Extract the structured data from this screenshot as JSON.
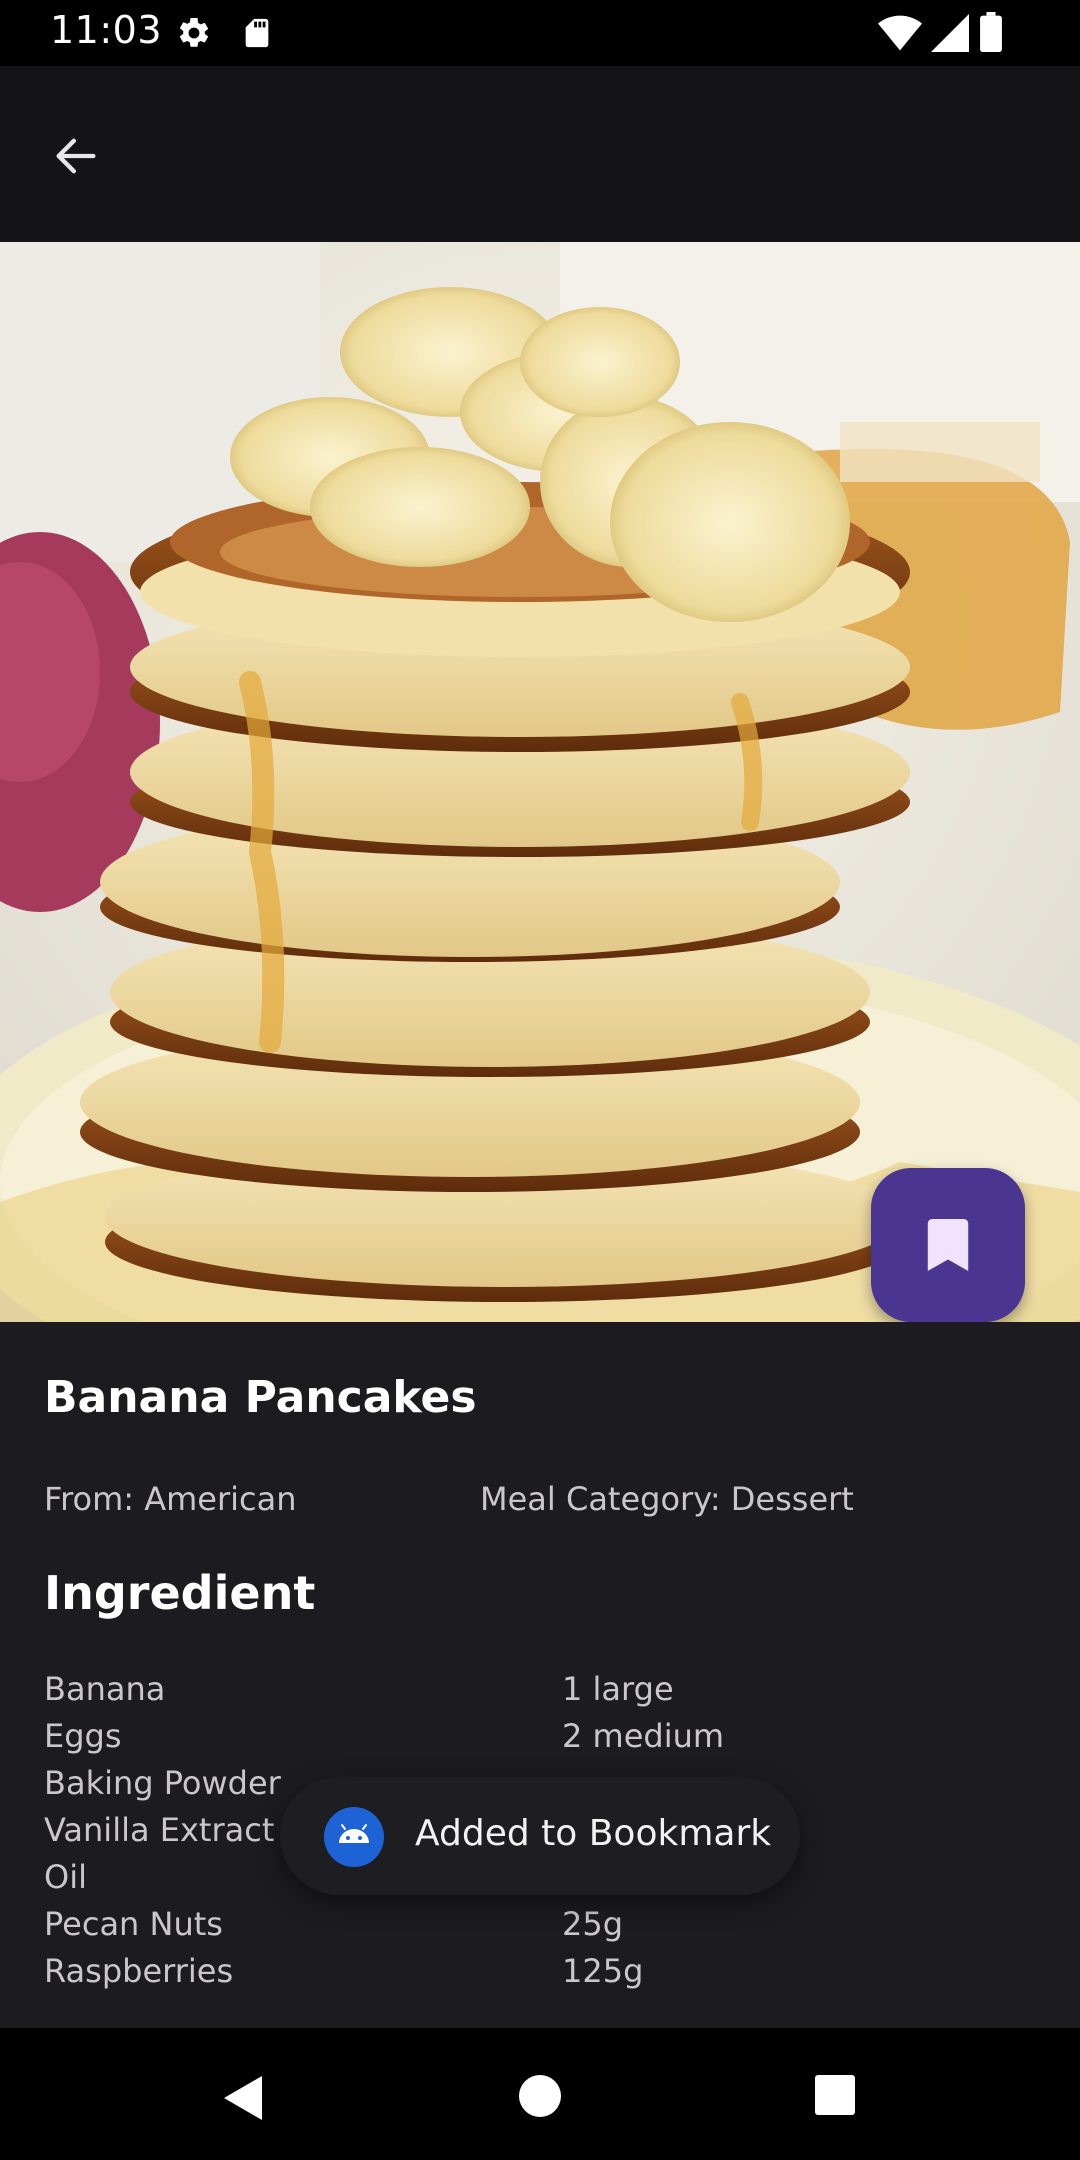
{
  "status_bar": {
    "time": "11:03",
    "icons": [
      "settings-icon",
      "sd-card-icon",
      "wifi-icon",
      "signal-icon",
      "battery-icon"
    ]
  },
  "app_bar": {
    "back_icon": "arrow-back-icon"
  },
  "recipe": {
    "title": "Banana Pancakes",
    "origin": "From: American",
    "category": "Meal Category: Dessert",
    "image_icon": "pancake-photo"
  },
  "fab": {
    "icon": "bookmark-icon",
    "color": "#4a3591"
  },
  "ingredients": {
    "heading": "Ingredient",
    "items": [
      {
        "name": "Banana",
        "qty": "1 large"
      },
      {
        "name": "Eggs",
        "qty": "2 medium"
      },
      {
        "name": "Baking Powder",
        "qty": ""
      },
      {
        "name": "Vanilla Extract",
        "qty": ""
      },
      {
        "name": "Oil",
        "qty": ""
      },
      {
        "name": "Pecan Nuts",
        "qty": "25g"
      },
      {
        "name": "Raspberries",
        "qty": "125g"
      }
    ]
  },
  "toast": {
    "message": "Added to Bookmark",
    "icon": "android-icon"
  },
  "nav_bar": {
    "icons": [
      "nav-back-icon",
      "nav-home-icon",
      "nav-recents-icon"
    ]
  },
  "colors": {
    "app_bar": "#141417",
    "content_bg": "#1c1b20",
    "secondary_text": "#c9c7cc",
    "accent": "#4a3591"
  }
}
